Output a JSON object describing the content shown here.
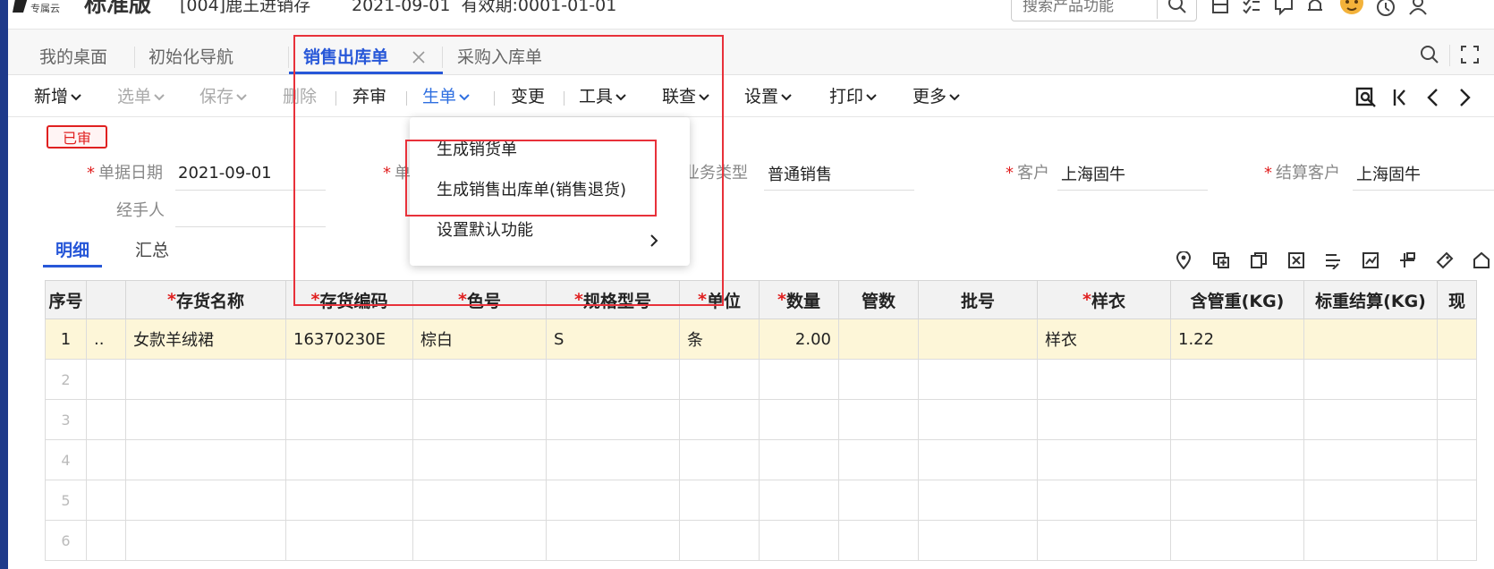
{
  "header": {
    "brand_small": "专属云",
    "brand_big": "标准版",
    "company": "[004]鹿王进销存",
    "date_validity": "2021-09-01  有效期:0001-01-01",
    "search_placeholder": "搜索产品功能"
  },
  "tabs": [
    {
      "label": "我的桌面"
    },
    {
      "label": "初始化导航"
    },
    {
      "label": "销售出库单",
      "active": true
    },
    {
      "label": "采购入库单"
    }
  ],
  "toolbar": {
    "items": [
      {
        "label": "新增",
        "state": "normal",
        "dropdown": true
      },
      {
        "label": "选单",
        "state": "disabled",
        "dropdown": true
      },
      {
        "label": "保存",
        "state": "disabled",
        "dropdown": true
      },
      {
        "label": "删除",
        "state": "disabled",
        "dropdown": false
      },
      {
        "label": "弃审",
        "state": "normal",
        "dropdown": false
      },
      {
        "label": "生单",
        "state": "active",
        "dropdown": true
      },
      {
        "label": "变更",
        "state": "normal",
        "dropdown": false
      },
      {
        "label": "工具",
        "state": "normal",
        "dropdown": true
      },
      {
        "label": "联查",
        "state": "normal",
        "dropdown": true
      },
      {
        "label": "设置",
        "state": "normal",
        "dropdown": true
      },
      {
        "label": "打印",
        "state": "normal",
        "dropdown": true
      },
      {
        "label": "更多",
        "state": "normal",
        "dropdown": true
      }
    ]
  },
  "status_badge": "已审",
  "form": {
    "doc_date_label": "单据日期",
    "doc_date_value": "2021-09-01",
    "doc_no_label": "单",
    "biz_type_label": "业务类型",
    "biz_type_value": "普通销售",
    "customer_label": "客户",
    "customer_value": "上海固牛",
    "settle_customer_label": "结算客户",
    "settle_customer_value": "上海固牛",
    "handler_label": "经手人"
  },
  "dropdown_menu": {
    "items": [
      {
        "label": "生成销货单"
      },
      {
        "label": "生成销售出库单(销售退货)"
      },
      {
        "label": "设置默认功能"
      }
    ]
  },
  "detail_tabs": [
    {
      "label": "明细",
      "active": true
    },
    {
      "label": "汇总",
      "active": false
    }
  ],
  "table": {
    "columns": [
      {
        "label": "序号",
        "required": false
      },
      {
        "label": "",
        "required": false
      },
      {
        "label": "存货名称",
        "required": true
      },
      {
        "label": "存货编码",
        "required": true
      },
      {
        "label": "色号",
        "required": true
      },
      {
        "label": "规格型号",
        "required": true
      },
      {
        "label": "单位",
        "required": true
      },
      {
        "label": "数量",
        "required": true
      },
      {
        "label": "管数",
        "required": false
      },
      {
        "label": "批号",
        "required": false
      },
      {
        "label": "样衣",
        "required": true
      },
      {
        "label": "含管重(KG)",
        "required": false
      },
      {
        "label": "标重结算(KG)",
        "required": false
      },
      {
        "label": "现",
        "required": false
      }
    ],
    "rows": [
      {
        "no": "1",
        "c1": "..",
        "name": "女款羊绒裙",
        "code": "16370230E",
        "color": "棕白",
        "spec": "S",
        "unit": "条",
        "qty": "2.00",
        "tubes": "",
        "batch": "",
        "sample": "样衣",
        "tube_weight": "1.22",
        "std_weight": "",
        "cur": ""
      },
      {
        "no": "2"
      },
      {
        "no": "3"
      },
      {
        "no": "4"
      },
      {
        "no": "5"
      },
      {
        "no": "6"
      }
    ]
  },
  "colors": {
    "accent": "#2757d8",
    "highlight_row": "#fdf6d8",
    "annotation_red": "#e8313a"
  },
  "icons": [
    "search-icon",
    "save-icon",
    "checklist-icon",
    "message-icon",
    "bell-icon",
    "avatar",
    "help-icon",
    "user-icon",
    "fullscreen-icon",
    "audit-view-icon",
    "first-page-icon",
    "prev-icon",
    "next-icon",
    "location-icon",
    "add-row-icon",
    "copy-row-icon",
    "delete-row-icon",
    "batch-icon",
    "chart-icon",
    "split-icon",
    "tag-icon",
    "home-icon"
  ]
}
